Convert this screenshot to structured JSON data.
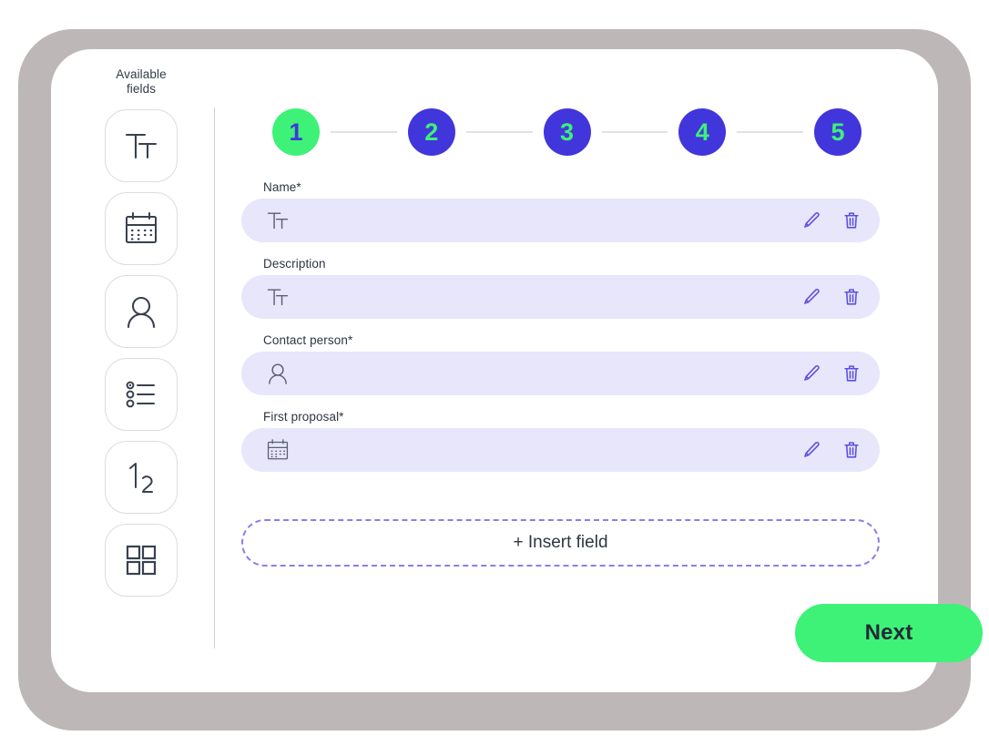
{
  "app": {
    "accent_green": "#3df277",
    "accent_blue": "#4136db",
    "field_bg": "#e8e6fb",
    "bezel_color": "#bdb7b7",
    "card_color": "#ffffff",
    "icon_stroke": "#39414f",
    "action_icon_color": "#5b4fe0"
  },
  "sidebar": {
    "title": "Available\nfields",
    "title_line1": "Available",
    "title_line2": "fields",
    "items": [
      {
        "icon": "text-icon",
        "name": "text-field-tile"
      },
      {
        "icon": "calendar-icon",
        "name": "date-field-tile"
      },
      {
        "icon": "person-icon",
        "name": "person-field-tile"
      },
      {
        "icon": "radio-list-icon",
        "name": "choice-field-tile"
      },
      {
        "icon": "number-icon",
        "name": "number-field-tile"
      },
      {
        "icon": "grid-icon",
        "name": "grid-field-tile"
      }
    ]
  },
  "stepper": {
    "steps": [
      {
        "label": "1",
        "state": "done"
      },
      {
        "label": "2",
        "state": "todo"
      },
      {
        "label": "3",
        "state": "todo"
      },
      {
        "label": "4",
        "state": "todo"
      },
      {
        "label": "5",
        "state": "todo"
      }
    ]
  },
  "form": {
    "rows": [
      {
        "label": "Name*",
        "icon": "text-icon",
        "value": "",
        "edit_icon": "pencil-icon",
        "delete_icon": "trash-icon"
      },
      {
        "label": "Description",
        "icon": "text-icon",
        "value": "",
        "edit_icon": "pencil-icon",
        "delete_icon": "trash-icon"
      },
      {
        "label": "Contact person*",
        "icon": "person-icon",
        "value": "",
        "edit_icon": "pencil-icon",
        "delete_icon": "trash-icon"
      },
      {
        "label": "First proposal*",
        "icon": "calendar-icon",
        "value": "",
        "edit_icon": "pencil-icon",
        "delete_icon": "trash-icon"
      }
    ],
    "insert_field_label": "+ Insert field"
  },
  "footer": {
    "next_label": "Next"
  }
}
